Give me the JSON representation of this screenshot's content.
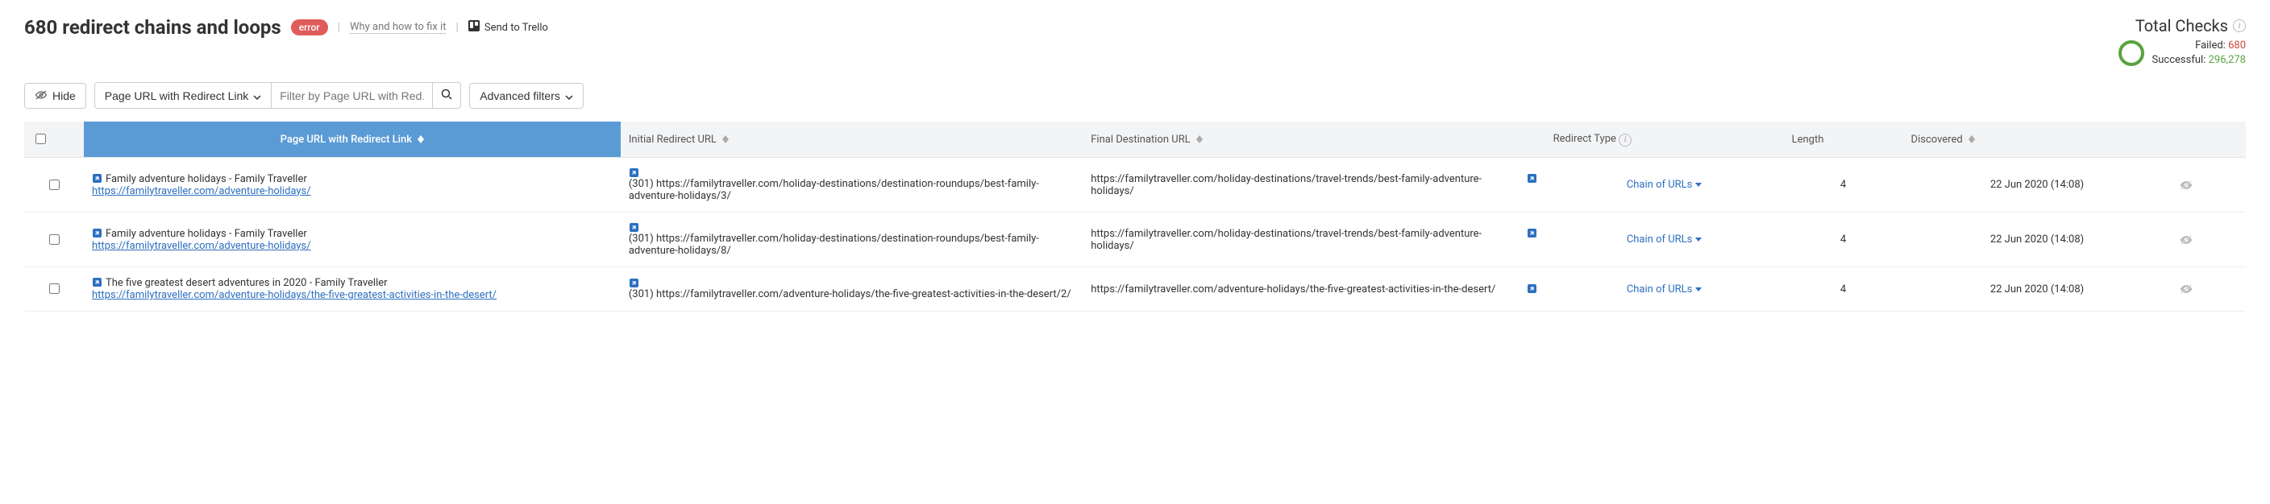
{
  "header": {
    "title": "680 redirect chains and loops",
    "error_label": "error",
    "why_link": "Why and how to fix it",
    "send_trello": "Send to Trello"
  },
  "totals": {
    "label": "Total Checks",
    "failed_label": "Failed:",
    "failed_value": "680",
    "success_label": "Successful:",
    "success_value": "296,278"
  },
  "toolbar": {
    "hide": "Hide",
    "filter_mode": "Page URL with Redirect Link",
    "filter_placeholder": "Filter by Page URL with Red…",
    "adv_filters": "Advanced filters"
  },
  "columns": {
    "page": "Page URL with Redirect Link",
    "initial": "Initial Redirect URL",
    "final": "Final Destination URL",
    "type": "Redirect Type",
    "length": "Length",
    "discovered": "Discovered"
  },
  "rows": [
    {
      "page_title": "Family adventure holidays - Family Traveller",
      "page_url": "https://familytraveller.com/adventure-holidays/",
      "initial": "(301) https://familytraveller.com/holiday-destinations/destination-roundups/best-family-adventure-holidays/3/",
      "final": "https://familytraveller.com/holiday-destinations/travel-trends/best-family-adventure-holidays/",
      "type": "Chain of URLs",
      "length": "4",
      "discovered": "22 Jun 2020 (14:08)"
    },
    {
      "page_title": "Family adventure holidays - Family Traveller",
      "page_url": "https://familytraveller.com/adventure-holidays/",
      "initial": "(301) https://familytraveller.com/holiday-destinations/destination-roundups/best-family-adventure-holidays/8/",
      "final": "https://familytraveller.com/holiday-destinations/travel-trends/best-family-adventure-holidays/",
      "type": "Chain of URLs",
      "length": "4",
      "discovered": "22 Jun 2020 (14:08)"
    },
    {
      "page_title": "The five greatest desert adventures in 2020 - Family Traveller",
      "page_url": "https://familytraveller.com/adventure-holidays/the-five-greatest-activities-in-the-desert/",
      "initial": "(301) https://familytraveller.com/adventure-holidays/the-five-greatest-activities-in-the-desert/2/",
      "final": "https://familytraveller.com/adventure-holidays/the-five-greatest-activities-in-the-desert/",
      "type": "Chain of URLs",
      "length": "4",
      "discovered": "22 Jun 2020 (14:08)"
    }
  ]
}
